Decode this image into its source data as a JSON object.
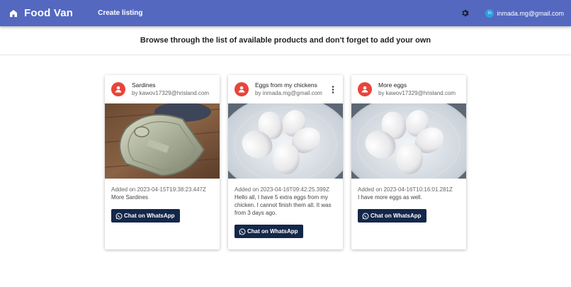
{
  "appbar": {
    "brand": "Food Van",
    "create_listing": "Create listing",
    "user_initial": "In",
    "user_email": "inmada.mg@gmail.com"
  },
  "subheader": {
    "text": "Browse through the list of available products and don't forget to add your own"
  },
  "colors": {
    "appbar": "#5468c0",
    "avatar": "#e8443a",
    "button": "#14274a"
  },
  "cards": [
    {
      "title": "Sardines",
      "owner": "by kawov17329@hrisland.com",
      "date": "Added on 2023-04-15T19:38:23.447Z",
      "description": "More Sardines",
      "button": "Chat on WhatsApp",
      "image": "sardine-can"
    },
    {
      "title": "Eggs from my chickens",
      "owner": "by inmada.mg@gmail.com",
      "date": "Added on 2023-04-16T09:42:25.399Z",
      "description": "Hello all, I have 5 extra eggs from my chicken. I cannot finish them all. It was from 3 days ago.",
      "button": "Chat on WhatsApp",
      "image": "eggs-bowl"
    },
    {
      "title": "More eggs",
      "owner": "by kawov17329@hrisland.com",
      "date": "Added on 2023-04-16T10:16:01.281Z",
      "description": "I have more eggs as well.",
      "button": "Chat on WhatsApp",
      "image": "eggs-bowl"
    }
  ]
}
